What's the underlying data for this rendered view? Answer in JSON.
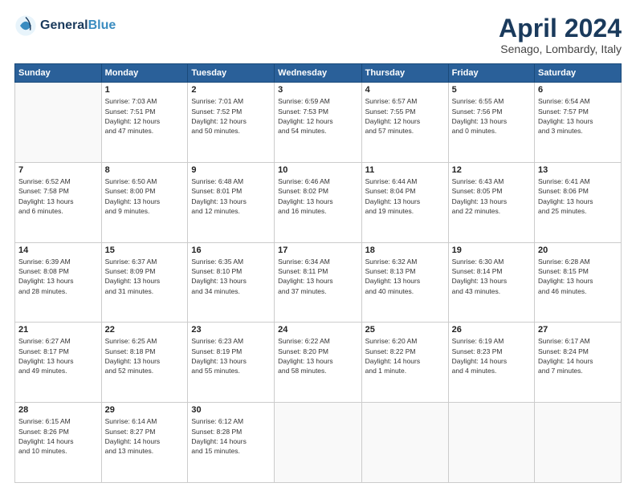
{
  "header": {
    "logo_line1": "General",
    "logo_line2": "Blue",
    "month_title": "April 2024",
    "subtitle": "Senago, Lombardy, Italy"
  },
  "weekdays": [
    "Sunday",
    "Monday",
    "Tuesday",
    "Wednesday",
    "Thursday",
    "Friday",
    "Saturday"
  ],
  "weeks": [
    [
      {
        "day": "",
        "info": ""
      },
      {
        "day": "1",
        "info": "Sunrise: 7:03 AM\nSunset: 7:51 PM\nDaylight: 12 hours\nand 47 minutes."
      },
      {
        "day": "2",
        "info": "Sunrise: 7:01 AM\nSunset: 7:52 PM\nDaylight: 12 hours\nand 50 minutes."
      },
      {
        "day": "3",
        "info": "Sunrise: 6:59 AM\nSunset: 7:53 PM\nDaylight: 12 hours\nand 54 minutes."
      },
      {
        "day": "4",
        "info": "Sunrise: 6:57 AM\nSunset: 7:55 PM\nDaylight: 12 hours\nand 57 minutes."
      },
      {
        "day": "5",
        "info": "Sunrise: 6:55 AM\nSunset: 7:56 PM\nDaylight: 13 hours\nand 0 minutes."
      },
      {
        "day": "6",
        "info": "Sunrise: 6:54 AM\nSunset: 7:57 PM\nDaylight: 13 hours\nand 3 minutes."
      }
    ],
    [
      {
        "day": "7",
        "info": "Sunrise: 6:52 AM\nSunset: 7:58 PM\nDaylight: 13 hours\nand 6 minutes."
      },
      {
        "day": "8",
        "info": "Sunrise: 6:50 AM\nSunset: 8:00 PM\nDaylight: 13 hours\nand 9 minutes."
      },
      {
        "day": "9",
        "info": "Sunrise: 6:48 AM\nSunset: 8:01 PM\nDaylight: 13 hours\nand 12 minutes."
      },
      {
        "day": "10",
        "info": "Sunrise: 6:46 AM\nSunset: 8:02 PM\nDaylight: 13 hours\nand 16 minutes."
      },
      {
        "day": "11",
        "info": "Sunrise: 6:44 AM\nSunset: 8:04 PM\nDaylight: 13 hours\nand 19 minutes."
      },
      {
        "day": "12",
        "info": "Sunrise: 6:43 AM\nSunset: 8:05 PM\nDaylight: 13 hours\nand 22 minutes."
      },
      {
        "day": "13",
        "info": "Sunrise: 6:41 AM\nSunset: 8:06 PM\nDaylight: 13 hours\nand 25 minutes."
      }
    ],
    [
      {
        "day": "14",
        "info": "Sunrise: 6:39 AM\nSunset: 8:08 PM\nDaylight: 13 hours\nand 28 minutes."
      },
      {
        "day": "15",
        "info": "Sunrise: 6:37 AM\nSunset: 8:09 PM\nDaylight: 13 hours\nand 31 minutes."
      },
      {
        "day": "16",
        "info": "Sunrise: 6:35 AM\nSunset: 8:10 PM\nDaylight: 13 hours\nand 34 minutes."
      },
      {
        "day": "17",
        "info": "Sunrise: 6:34 AM\nSunset: 8:11 PM\nDaylight: 13 hours\nand 37 minutes."
      },
      {
        "day": "18",
        "info": "Sunrise: 6:32 AM\nSunset: 8:13 PM\nDaylight: 13 hours\nand 40 minutes."
      },
      {
        "day": "19",
        "info": "Sunrise: 6:30 AM\nSunset: 8:14 PM\nDaylight: 13 hours\nand 43 minutes."
      },
      {
        "day": "20",
        "info": "Sunrise: 6:28 AM\nSunset: 8:15 PM\nDaylight: 13 hours\nand 46 minutes."
      }
    ],
    [
      {
        "day": "21",
        "info": "Sunrise: 6:27 AM\nSunset: 8:17 PM\nDaylight: 13 hours\nand 49 minutes."
      },
      {
        "day": "22",
        "info": "Sunrise: 6:25 AM\nSunset: 8:18 PM\nDaylight: 13 hours\nand 52 minutes."
      },
      {
        "day": "23",
        "info": "Sunrise: 6:23 AM\nSunset: 8:19 PM\nDaylight: 13 hours\nand 55 minutes."
      },
      {
        "day": "24",
        "info": "Sunrise: 6:22 AM\nSunset: 8:20 PM\nDaylight: 13 hours\nand 58 minutes."
      },
      {
        "day": "25",
        "info": "Sunrise: 6:20 AM\nSunset: 8:22 PM\nDaylight: 14 hours\nand 1 minute."
      },
      {
        "day": "26",
        "info": "Sunrise: 6:19 AM\nSunset: 8:23 PM\nDaylight: 14 hours\nand 4 minutes."
      },
      {
        "day": "27",
        "info": "Sunrise: 6:17 AM\nSunset: 8:24 PM\nDaylight: 14 hours\nand 7 minutes."
      }
    ],
    [
      {
        "day": "28",
        "info": "Sunrise: 6:15 AM\nSunset: 8:26 PM\nDaylight: 14 hours\nand 10 minutes."
      },
      {
        "day": "29",
        "info": "Sunrise: 6:14 AM\nSunset: 8:27 PM\nDaylight: 14 hours\nand 13 minutes."
      },
      {
        "day": "30",
        "info": "Sunrise: 6:12 AM\nSunset: 8:28 PM\nDaylight: 14 hours\nand 15 minutes."
      },
      {
        "day": "",
        "info": ""
      },
      {
        "day": "",
        "info": ""
      },
      {
        "day": "",
        "info": ""
      },
      {
        "day": "",
        "info": ""
      }
    ]
  ]
}
